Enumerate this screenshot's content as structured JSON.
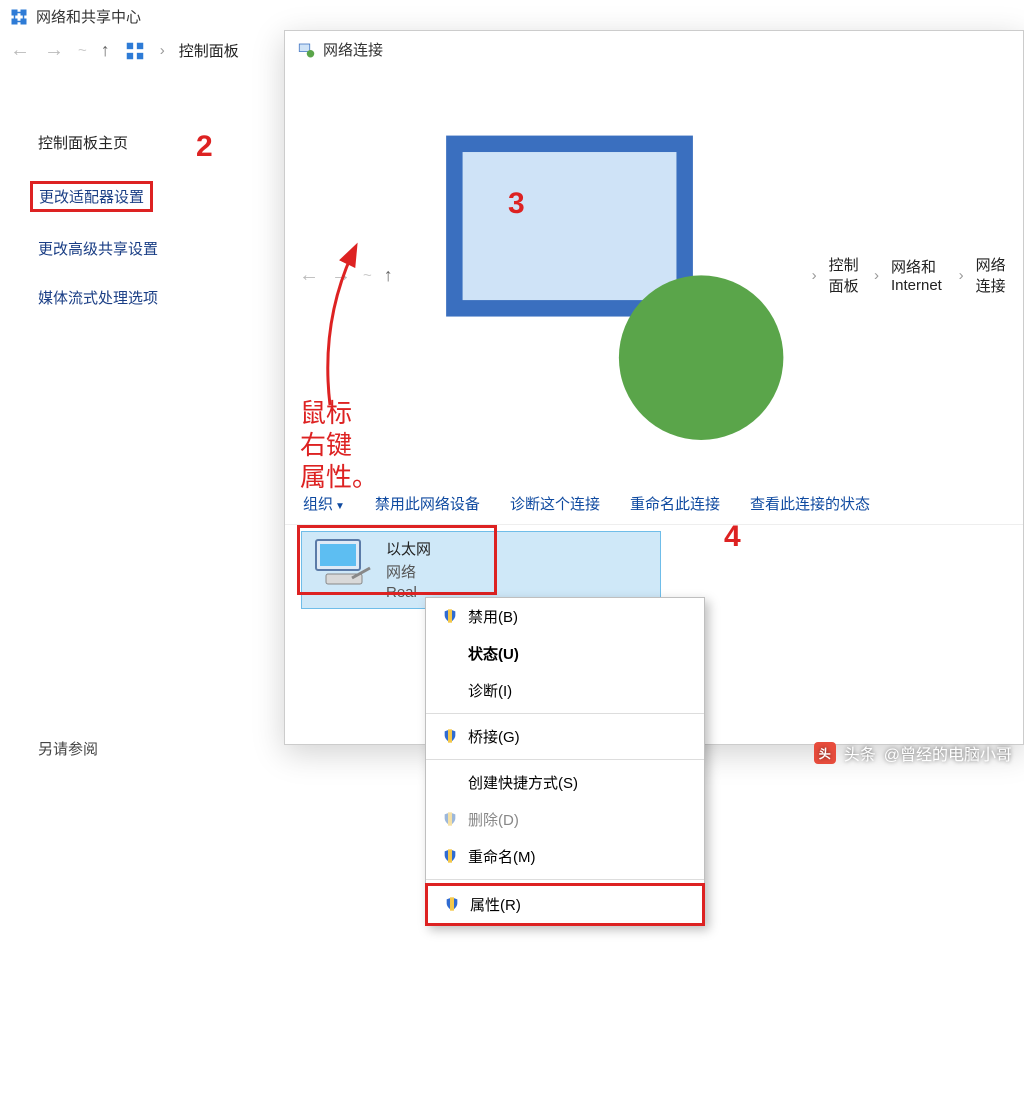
{
  "win1": {
    "title": "网络和共享中心",
    "breadcrumb": {
      "b1": "控制面板"
    },
    "sidebar": {
      "home": "控制面板主页",
      "adapter_settings": "更改适配器设置",
      "advanced_sharing": "更改高级共享设置",
      "media_stream": "媒体流式处理选项"
    },
    "see_also": "另请参阅"
  },
  "win2": {
    "title": "网络连接",
    "breadcrumb": {
      "b1": "控制面板",
      "b2": "网络和 Internet",
      "b3": "网络连接"
    },
    "toolbar": {
      "organize": "组织",
      "disable": "禁用此网络设备",
      "diagnose": "诊断这个连接",
      "rename": "重命名此连接",
      "view_status": "查看此连接的状态"
    },
    "adapter": {
      "name": "以太网",
      "network": "网络",
      "device": "Real"
    },
    "context_menu": {
      "disable": "禁用(B)",
      "status": "状态(U)",
      "diagnose": "诊断(I)",
      "bridge": "桥接(G)",
      "shortcut": "创建快捷方式(S)",
      "delete": "删除(D)",
      "rename": "重命名(M)",
      "properties": "属性(R)"
    }
  },
  "annotations": {
    "n2": "2",
    "n3": "3",
    "n4": "4",
    "right_click": "鼠标\n右键\n属性。"
  },
  "watermark": {
    "prefix": "头条",
    "author": "@曾经的电脑小哥"
  }
}
